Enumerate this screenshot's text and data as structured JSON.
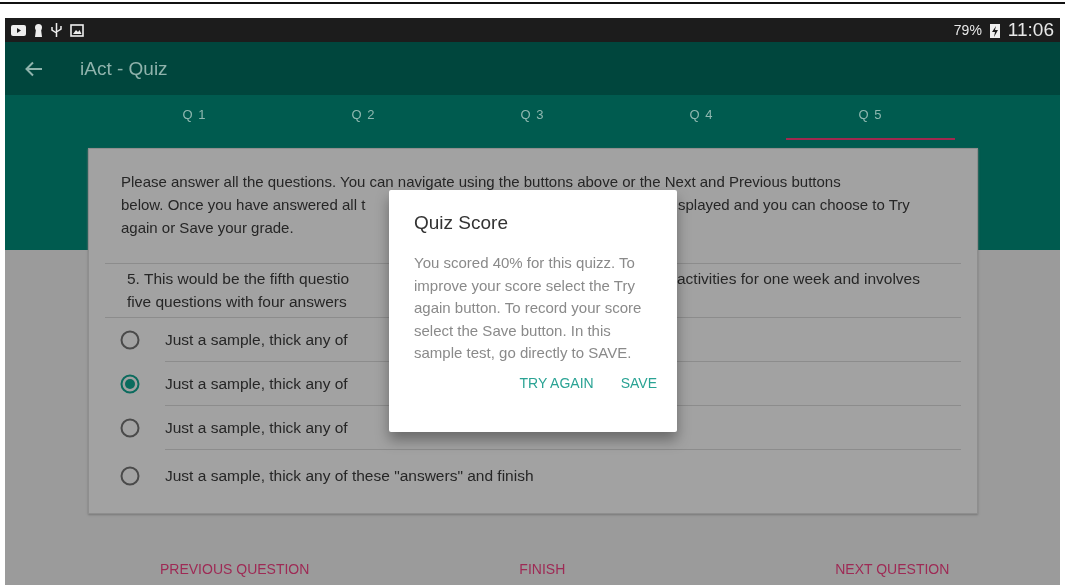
{
  "status_bar": {
    "battery": "79%",
    "time": "11:06"
  },
  "app_bar": {
    "title": "iAct - Quiz"
  },
  "tabs": [
    {
      "label": "Q 1",
      "selected": false
    },
    {
      "label": "Q 2",
      "selected": false
    },
    {
      "label": "Q 3",
      "selected": false
    },
    {
      "label": "Q 4",
      "selected": false
    },
    {
      "label": "Q 5",
      "selected": true
    }
  ],
  "instructions": {
    "lines": [
      [
        "Please answer all the questions. You can navigate using the buttons above or the Next and Previous buttons"
      ],
      [
        "below. Once you have answered all t",
        "splayed and you can choose to Try"
      ],
      [
        "again or Save your grade."
      ]
    ]
  },
  "question": {
    "lines": [
      [
        "5. This would be the fifth questio",
        "activities for one week and involves"
      ],
      [
        "five questions with four answers"
      ]
    ]
  },
  "answers": [
    {
      "text": "Just a sample, thick any of",
      "selected": false
    },
    {
      "text": "Just a sample, thick any of",
      "selected": true
    },
    {
      "text": "Just a sample, thick any of",
      "selected": false
    },
    {
      "text": "Just a sample, thick any of these \"answers\" and finish",
      "selected": false
    }
  ],
  "dialog": {
    "title": "Quiz Score",
    "message": "You scored 40% for this quizz. To improve your score select the Try again button. To record your score select the Save button. In this sample test, go directly to SAVE.",
    "buttons": [
      "TRY AGAIN",
      "SAVE"
    ]
  },
  "bottom_nav": [
    "PREVIOUS QUESTION",
    "FINISH",
    "NEXT QUESTION"
  ]
}
